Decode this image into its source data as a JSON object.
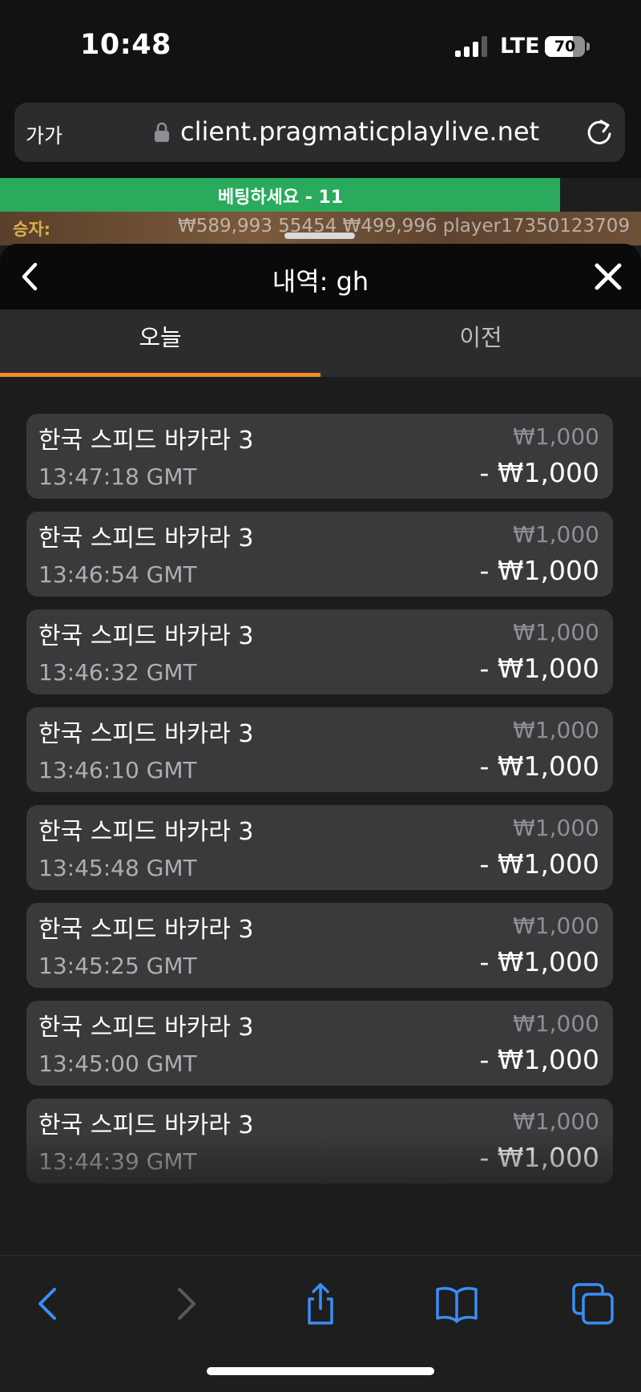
{
  "status_bar": {
    "time": "10:48",
    "network": "LTE",
    "battery": "70",
    "battery_level": 0.7
  },
  "address_bar": {
    "text_size": "가가",
    "url": "client.pragmaticplaylive.net"
  },
  "game_strip": {
    "betting_text": "베팅하세요 - 11",
    "betting_progress": 0.874,
    "winners_label": "승자:",
    "winners_text": "₩589,993 55454   ₩499,996 player17350123709"
  },
  "sheet": {
    "title": "내역: gh",
    "tabs": [
      {
        "label": "오늘"
      },
      {
        "label": "이전"
      }
    ]
  },
  "history": [
    {
      "game": "한국 스피드 바카라 3",
      "time": "13:47:18 GMT",
      "bet": "₩1,000",
      "result": "- ₩1,000"
    },
    {
      "game": "한국 스피드 바카라 3",
      "time": "13:46:54 GMT",
      "bet": "₩1,000",
      "result": "- ₩1,000"
    },
    {
      "game": "한국 스피드 바카라 3",
      "time": "13:46:32 GMT",
      "bet": "₩1,000",
      "result": "- ₩1,000"
    },
    {
      "game": "한국 스피드 바카라 3",
      "time": "13:46:10 GMT",
      "bet": "₩1,000",
      "result": "- ₩1,000"
    },
    {
      "game": "한국 스피드 바카라 3",
      "time": "13:45:48 GMT",
      "bet": "₩1,000",
      "result": "- ₩1,000"
    },
    {
      "game": "한국 스피드 바카라 3",
      "time": "13:45:25 GMT",
      "bet": "₩1,000",
      "result": "- ₩1,000"
    },
    {
      "game": "한국 스피드 바카라 3",
      "time": "13:45:00 GMT",
      "bet": "₩1,000",
      "result": "- ₩1,000"
    },
    {
      "game": "한국 스피드 바카라 3",
      "time": "13:44:39 GMT",
      "bet": "₩1,000",
      "result": "- ₩1,000"
    }
  ],
  "toolbar": {
    "icons": [
      "back-icon",
      "forward-icon",
      "share-icon",
      "bookmarks-icon",
      "tabs-icon"
    ],
    "accent": "#3a8ef6",
    "disabled": "#5a5a5e"
  },
  "colors": {
    "tab_accent": "#f08c22",
    "progress_green": "#2aaa5c",
    "card_bg": "#3a3a3c"
  }
}
